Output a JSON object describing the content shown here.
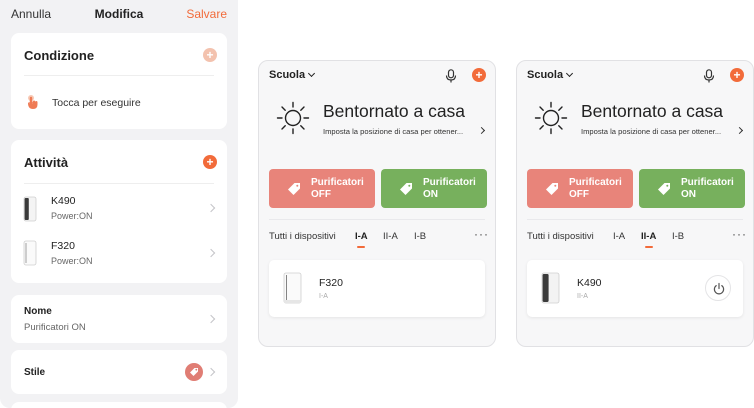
{
  "colors": {
    "accent": "#f26b3a",
    "scene_off": "#e8847a",
    "scene_on": "#77b05d"
  },
  "edit": {
    "cancel_label": "Annulla",
    "title": "Modifica",
    "save_label": "Salvare",
    "condition": {
      "heading": "Condizione",
      "trigger_label": "Tocca per eseguire",
      "trigger_icon": "hand-tap-icon"
    },
    "activity": {
      "heading": "Attività",
      "devices": [
        {
          "name": "K490",
          "state": "Power:ON"
        },
        {
          "name": "F320",
          "state": "Power:ON"
        }
      ]
    },
    "name_field": {
      "label": "Nome",
      "value": "Purificatori ON"
    },
    "style_field": {
      "label": "Stile",
      "icon": "tag-icon"
    }
  },
  "screens": [
    {
      "home": "Scuola",
      "welcome_title": "Bentornato a casa",
      "welcome_sub": "Imposta la posizione di casa per ottener...",
      "scenes": [
        {
          "line1": "Purificatori",
          "line2": "OFF"
        },
        {
          "line1": "Purificatori",
          "line2": "ON"
        }
      ],
      "tabs": [
        "Tutti i dispositivi",
        "I-A",
        "II-A",
        "I-B"
      ],
      "active_tab": "I-A",
      "more_label": "···",
      "device": {
        "name": "F320",
        "room": "I-A",
        "power_button": false
      }
    },
    {
      "home": "Scuola",
      "welcome_title": "Bentornato a casa",
      "welcome_sub": "Imposta la posizione di casa per ottener...",
      "scenes": [
        {
          "line1": "Purificatori",
          "line2": "OFF"
        },
        {
          "line1": "Purificatori",
          "line2": "ON"
        }
      ],
      "tabs": [
        "Tutti i dispositivi",
        "I-A",
        "II-A",
        "I-B"
      ],
      "active_tab": "II-A",
      "more_label": "···",
      "device": {
        "name": "K490",
        "room": "II-A",
        "power_button": true
      }
    }
  ]
}
